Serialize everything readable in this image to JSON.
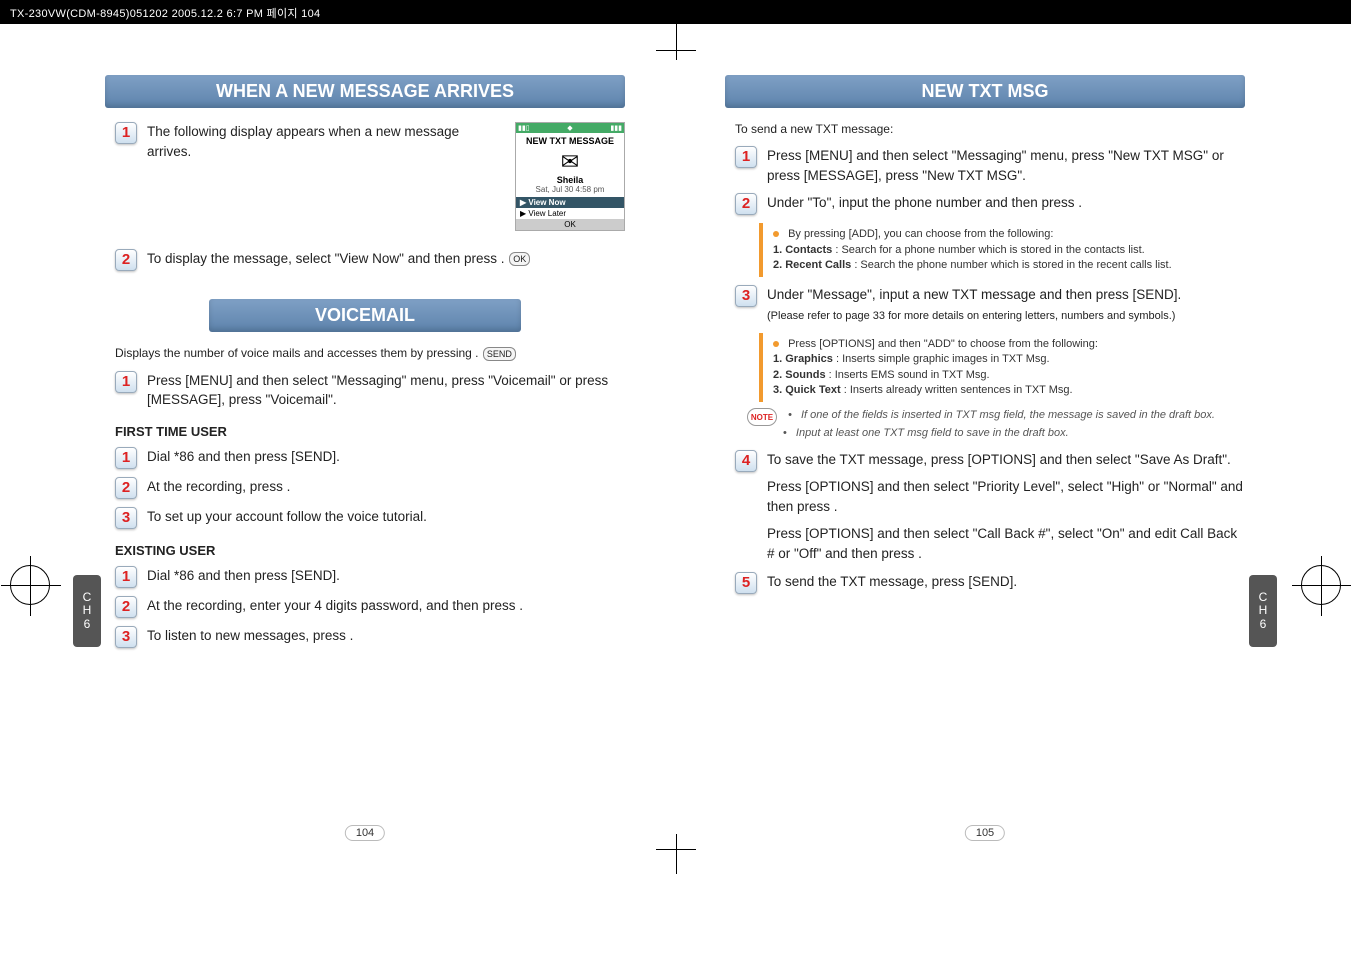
{
  "header_strip": "TX-230VW(CDM-8945)051202  2005.12.2 6:7 PM  페이지 104",
  "left_page": {
    "section1_title": "WHEN A NEW MESSAGE ARRIVES",
    "step1": "The following display appears when a new message arrives.",
    "phone": {
      "screen_title": "NEW TXT MESSAGE",
      "envelope": "✉",
      "sender": "Sheila",
      "date": "Sat, Jul 30  4:58 pm",
      "opt1": "▶ View Now",
      "opt2": "▶ View Later",
      "ok": "OK"
    },
    "step2": "To display the message, select \"View Now\" and then press       .",
    "section2_title": "VOICEMAIL",
    "voicemail_intro": "Displays the number of voice mails and accesses them by pressing        .",
    "vm_step1": "Press       [MENU] and then select \"Messaging\" menu, press       \"Voicemail\" or press       [MESSAGE], press       \"Voicemail\".",
    "first_time_user": "FIRST TIME USER",
    "ft_step1": "Dial *86 and then press        [SEND].",
    "ft_step2": "At the recording, press       .",
    "ft_step3": "To set up your account follow the voice tutorial.",
    "existing_user": "EXISTING USER",
    "ex_step1": "Dial *86 and then press        [SEND].",
    "ex_step2": "At the recording, enter your 4 digits password, and then press       .",
    "ex_step3": "To listen to new messages, press       .",
    "page_num": "104",
    "tab": "CH6"
  },
  "right_page": {
    "section_title": "NEW TXT MSG",
    "intro": "To send a new TXT message:",
    "step1": "Press       [MENU] and then select \"Messaging\" menu, press       \"New TXT MSG\" or press       [MESSAGE], press       \"New TXT MSG\".",
    "step2": "Under \"To\", input the phone number and then press       .",
    "note1_lead": "By pressing       [ADD], you can choose from the following:",
    "note1_item1_label": "1. Contacts",
    "note1_item1_text": " : Search for a phone number which is stored in the contacts list.",
    "note1_item2_label": "2. Recent Calls",
    "note1_item2_text": " : Search the phone number which is stored in the recent calls list.",
    "step3_a": "Under \"Message\", input a new TXT message and then press       [SEND].",
    "step3_b": "(Please refer to page 33 for more details on entering letters, numbers and symbols.)",
    "note2_lead": "Press       [OPTIONS] and then \"ADD\" to choose from the following:",
    "note2_item1_label": "1. Graphics",
    "note2_item1_text": " : Inserts simple graphic images in TXT Msg.",
    "note2_item2_label": "2. Sounds",
    "note2_item2_text": " : Inserts EMS sound in TXT Msg.",
    "note2_item3_label": "3. Quick Text",
    "note2_item3_text": " : Inserts already written sentences in TXT Msg.",
    "tip_badge": "NOTE",
    "tip1": "If one of the fields is inserted in TXT msg field, the message is saved in the draft box.",
    "tip2": "Input at least one TXT msg field to save in the draft box.",
    "step4_a": "To save the TXT message, press       [OPTIONS] and then select \"Save As Draft\".",
    "step4_b": "Press       [OPTIONS] and then select \"Priority Level\", select \"High\" or \"Normal\" and then press       .",
    "step4_c": "Press       [OPTIONS] and then select \"Call Back #\", select \"On\" and edit Call Back # or \"Off\" and then press       .",
    "step5": "To send the TXT message, press       [SEND].",
    "page_num": "105",
    "tab": "CH6"
  }
}
